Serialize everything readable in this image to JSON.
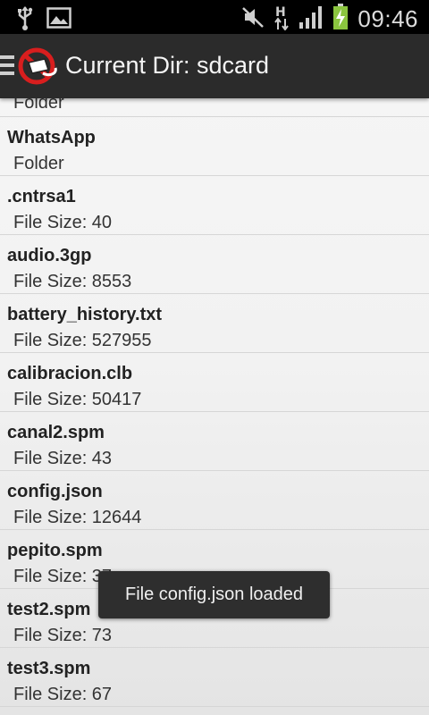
{
  "status_bar": {
    "time": "09:46",
    "icons": [
      "usb-icon",
      "image-icon",
      "mute-icon",
      "network-h-icon",
      "signal-icon",
      "battery-charging-icon"
    ]
  },
  "action_bar": {
    "title": "Current Dir: sdcard"
  },
  "file_list": [
    {
      "name": "",
      "detail": "Folder"
    },
    {
      "name": "WhatsApp",
      "detail": "Folder"
    },
    {
      "name": ".cntrsa1",
      "detail": "File Size: 40"
    },
    {
      "name": "audio.3gp",
      "detail": "File Size: 8553"
    },
    {
      "name": "battery_history.txt",
      "detail": "File Size: 527955"
    },
    {
      "name": "calibracion.clb",
      "detail": "File Size: 50417"
    },
    {
      "name": "canal2.spm",
      "detail": "File Size: 43"
    },
    {
      "name": "config.json",
      "detail": "File Size: 12644"
    },
    {
      "name": "pepito.spm",
      "detail": "File Size: 37"
    },
    {
      "name": "test2.spm",
      "detail": "File Size: 73"
    },
    {
      "name": "test3.spm",
      "detail": "File Size: 67"
    }
  ],
  "toast": {
    "message": "File config.json loaded"
  },
  "colors": {
    "status_bar_bg": "#000000",
    "action_bar_bg": "#2b2b2b",
    "logo_red": "#d81e1e",
    "battery_green": "#8bc53f"
  }
}
